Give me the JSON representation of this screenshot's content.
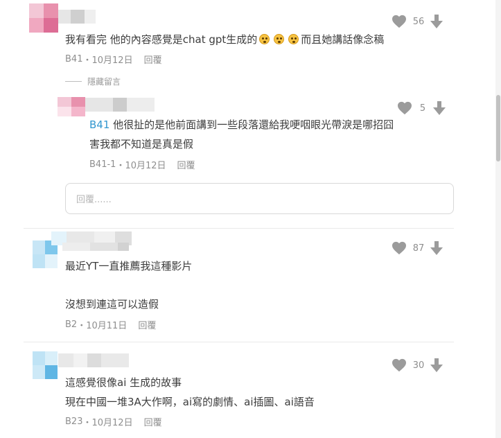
{
  "colors": {
    "icon_gray": "#9b9b9b",
    "floor_tag": "#3397cf",
    "meta_text": "#8e8e8e"
  },
  "comments": [
    {
      "text": "我有看完 他的內容感覺是chat gpt生成的",
      "text_after_emoji": "而且她講話像念稿",
      "emoji": "flushed-face",
      "likes": "56",
      "floor": "B41",
      "date": "10月12日",
      "reply_label": "回覆"
    },
    {
      "tag": "B41",
      "line1": "他很扯的是他前面講到一些段落還給我哽咽眼光帶淚是哪招囧",
      "line2": "害我都不知道是真是假",
      "likes": "5",
      "floor": "B41-1",
      "date": "10月12日",
      "reply_label": "回覆"
    },
    {
      "line1": "最近YT一直推薦我這種影片",
      "line2": "沒想到連這可以造假",
      "likes": "87",
      "floor": "B2",
      "date": "10月11日",
      "reply_label": "回覆"
    },
    {
      "line1": "這感覺很像ai 生成的故事",
      "line2": "現在中國一堆3A大作啊，ai寫的劇情、ai插圖、ai語音",
      "likes": "30",
      "floor": "B23",
      "date": "10月12日",
      "reply_label": "回覆"
    }
  ],
  "hide_comments_label": "隱藏留言",
  "reply_box": {
    "placeholder": "回覆......"
  },
  "meta_separator": "・",
  "icons": {
    "like": "heart-icon",
    "dislike": "down-arrow-icon"
  }
}
